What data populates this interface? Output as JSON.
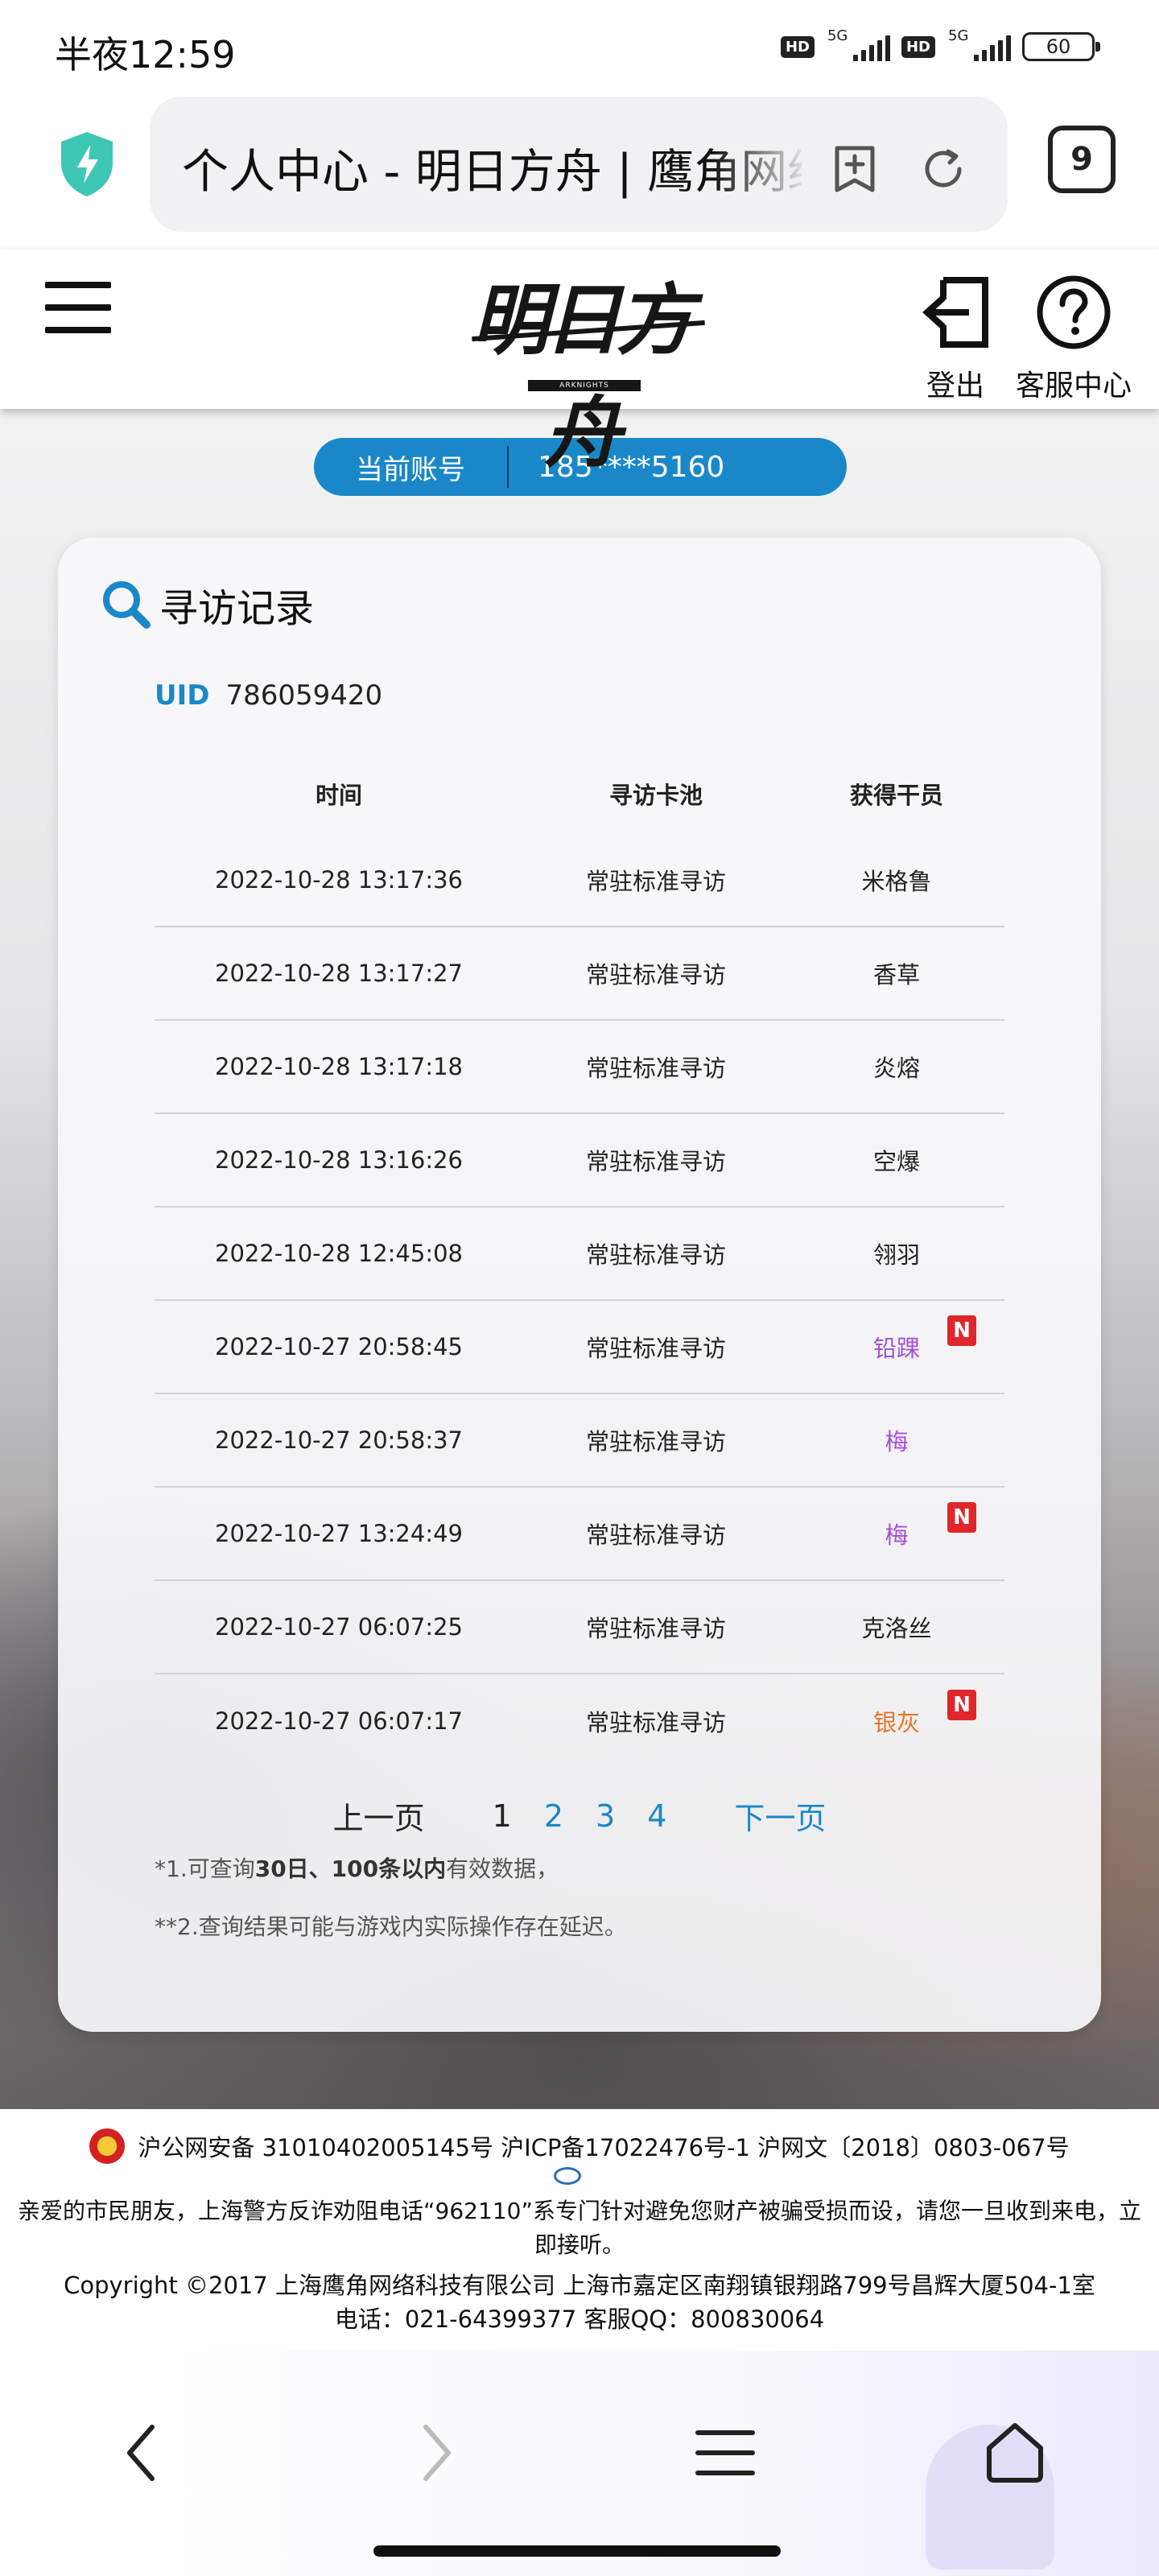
{
  "status_bar": {
    "time": "半夜12:59",
    "hd1": "HD",
    "net1": "5G",
    "hd2": "HD",
    "net2": "5G",
    "battery": "60"
  },
  "browser": {
    "url_title": "个人中心 - 明日方舟 | 鹰角网络",
    "tab_count": "9",
    "icons": [
      "shield-icon",
      "bookmark-add-icon",
      "reload-icon"
    ]
  },
  "site_header": {
    "logo_text": "明日方舟",
    "logo_sub": "ARKNIGHTS",
    "logout_label": "登出",
    "support_label": "客服中心"
  },
  "account": {
    "label": "当前账号",
    "value": "185****5160"
  },
  "records": {
    "title": "寻访记录",
    "uid_label": "UID",
    "uid_value": "786059420",
    "columns": [
      "时间",
      "寻访卡池",
      "获得干员"
    ],
    "rows": [
      {
        "time": "2022-10-28 13:17:36",
        "pool": "常驻标准寻访",
        "operator": "米格鲁",
        "color": "#222222",
        "new": ""
      },
      {
        "time": "2022-10-28 13:17:27",
        "pool": "常驻标准寻访",
        "operator": "香草",
        "color": "#222222",
        "new": ""
      },
      {
        "time": "2022-10-28 13:17:18",
        "pool": "常驻标准寻访",
        "operator": "炎熔",
        "color": "#222222",
        "new": ""
      },
      {
        "time": "2022-10-28 13:16:26",
        "pool": "常驻标准寻访",
        "operator": "空爆",
        "color": "#222222",
        "new": ""
      },
      {
        "time": "2022-10-28 12:45:08",
        "pool": "常驻标准寻访",
        "operator": "翎羽",
        "color": "#222222",
        "new": ""
      },
      {
        "time": "2022-10-27 20:58:45",
        "pool": "常驻标准寻访",
        "operator": "铅踝",
        "color": "#a64fd8",
        "new": "N"
      },
      {
        "time": "2022-10-27 20:58:37",
        "pool": "常驻标准寻访",
        "operator": "梅",
        "color": "#a64fd8",
        "new": ""
      },
      {
        "time": "2022-10-27 13:24:49",
        "pool": "常驻标准寻访",
        "operator": "梅",
        "color": "#a64fd8",
        "new": "N"
      },
      {
        "time": "2022-10-27 06:07:25",
        "pool": "常驻标准寻访",
        "operator": "克洛丝",
        "color": "#222222",
        "new": ""
      },
      {
        "time": "2022-10-27 06:07:17",
        "pool": "常驻标准寻访",
        "operator": "银灰",
        "color": "#e8772a",
        "new": "N"
      }
    ],
    "pager": {
      "prev": "上一页",
      "pages": [
        "1",
        "2",
        "3",
        "4"
      ],
      "current": "1",
      "next": "下一页"
    },
    "note1_a": "*1.可查询",
    "note1_b": "30日、100条以内",
    "note1_c": "有效数据，",
    "note2": "**2.查询结果可能与游戏内实际操作存在延迟。"
  },
  "footer": {
    "line1": "沪公网安备 31010402005145号  沪ICP备17022476号-1  沪网文〔2018〕0803-067号",
    "line2": "亲爱的市民朋友，上海警方反诈劝阻电话“962110”系专门针对避免您财产被骗受损而设，请您一旦收到来电，立即接听。",
    "line3": "Copyright ©2017 上海鹰角网络科技有限公司  上海市嘉定区南翔镇银翔路799号昌辉大厦504-1室",
    "line4": "电话：021-64399377 客服QQ：800830064"
  },
  "accent_color": "#1a88c8"
}
